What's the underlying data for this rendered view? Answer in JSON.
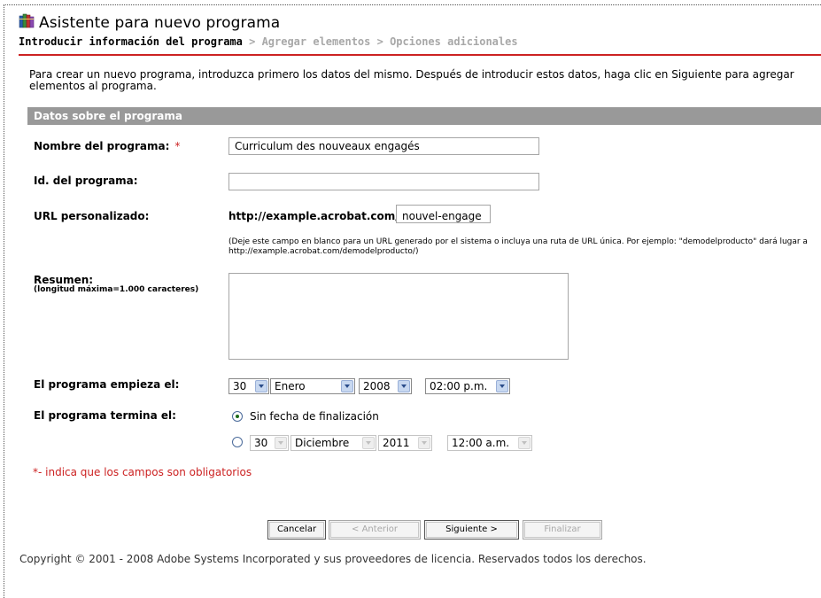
{
  "wizard": {
    "title": "Asistente para nuevo programa",
    "icon": "books-icon"
  },
  "breadcrumb": {
    "current": "Introducir información del programa",
    "sep1": " > ",
    "step2": "Agregar elementos",
    "sep2": " > ",
    "step3": "Opciones adicionales"
  },
  "intro": "Para crear un nuevo programa, introduzca primero los datos del mismo. Después de introducir estos datos, haga clic en Siguiente para agregar elementos al programa.",
  "section": {
    "title": "Datos sobre el programa"
  },
  "fields": {
    "name": {
      "label": "Nombre del programa:",
      "required_mark": "*",
      "value": "Curriculum des nouveaux engagés"
    },
    "id": {
      "label": "Id. del programa:",
      "value": ""
    },
    "url": {
      "label": "URL personalizado:",
      "prefix": "http://example.acrobat.com/",
      "value": "nouvel-engage",
      "note": "(Deje este campo en blanco para un URL generado por el sistema o incluya una ruta de URL única. Por ejemplo: \"demodelproducto\" dará lugar a http://example.acrobat.com/demodelproducto/)"
    },
    "summary": {
      "label": "Resumen:",
      "sublabel": "(longitud máxima=1.000 caracteres)",
      "value": ""
    },
    "start": {
      "label": "El programa empieza el:",
      "day": "30",
      "month": "Enero",
      "year": "2008",
      "time": "02:00 p.m."
    },
    "end": {
      "label": "El programa termina el:",
      "no_end_label": "Sin fecha de finalización",
      "no_end_selected": true,
      "day": "30",
      "month": "Diciembre",
      "year": "2011",
      "time": "12:00 a.m."
    }
  },
  "required_note": "*- indica que los campos son obligatorios",
  "buttons": {
    "cancel": "Cancelar",
    "previous": "< Anterior",
    "next": "Siguiente >",
    "finish": "Finalizar"
  },
  "copyright": "Copyright © 2001 - 2008 Adobe Systems Incorporated y sus proveedores de licencia. Reservados todos los derechos.",
  "colors": {
    "accent_red": "#cc2222",
    "section_bar": "#999999"
  }
}
